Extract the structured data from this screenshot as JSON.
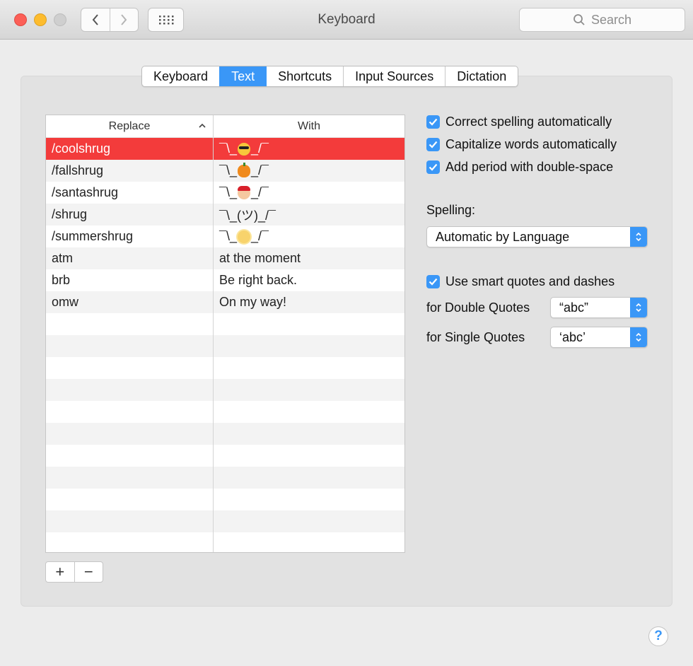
{
  "window": {
    "title": "Keyboard"
  },
  "search": {
    "placeholder": "Search"
  },
  "tabs": [
    {
      "label": "Keyboard",
      "active": false
    },
    {
      "label": "Text",
      "active": true
    },
    {
      "label": "Shortcuts",
      "active": false
    },
    {
      "label": "Input Sources",
      "active": false
    },
    {
      "label": "Dictation",
      "active": false
    }
  ],
  "table": {
    "col_replace": "Replace",
    "col_with": "With",
    "rows": [
      {
        "replace": "/coolshrug",
        "with_pre": "¯\\_",
        "emoji": "smiling-face-with-sunglasses",
        "with_post": "_/¯",
        "selected": true
      },
      {
        "replace": "/fallshrug",
        "with_pre": "¯\\_",
        "emoji": "jack-o-lantern",
        "with_post": "_/¯"
      },
      {
        "replace": "/santashrug",
        "with_pre": "¯\\_",
        "emoji": "santa-claus",
        "with_post": "_/¯"
      },
      {
        "replace": "/shrug",
        "with": "¯\\_(ツ)_/¯"
      },
      {
        "replace": "/summershrug",
        "with_pre": "¯\\_",
        "emoji": "sun-with-face",
        "with_post": "_/¯"
      },
      {
        "replace": "atm",
        "with": "at the moment"
      },
      {
        "replace": "brb",
        "with": "Be right back."
      },
      {
        "replace": "omw",
        "with": "On my way!"
      }
    ]
  },
  "buttons": {
    "add": "+",
    "remove": "−"
  },
  "options": {
    "correct_spelling": "Correct spelling automatically",
    "capitalize": "Capitalize words automatically",
    "period": "Add period with double-space",
    "spelling_label": "Spelling:",
    "spelling_value": "Automatic by Language",
    "smart_quotes": "Use smart quotes and dashes",
    "double_label": "for Double Quotes",
    "double_value": "“abc”",
    "single_label": "for Single Quotes",
    "single_value": "‘abc’"
  },
  "help": "?",
  "colors": {
    "accent": "#3a97f7",
    "selection": "#f33b3b"
  }
}
